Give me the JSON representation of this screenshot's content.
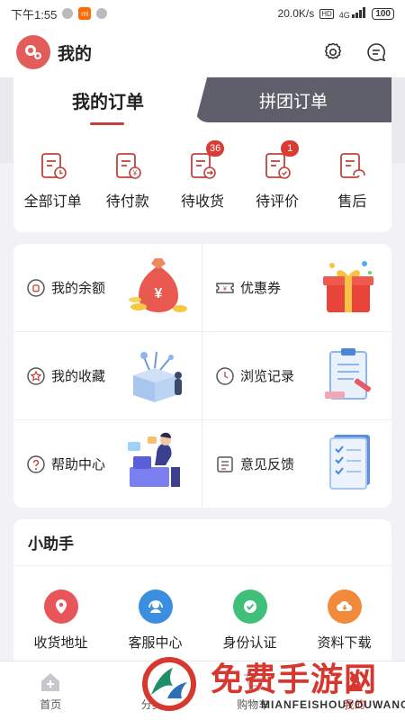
{
  "status_bar": {
    "time": "下午1:55",
    "speed": "20.0K/s",
    "hd": "HD",
    "network": "4G",
    "battery": "100"
  },
  "header": {
    "title": "我的"
  },
  "order_tabs": {
    "active": "我的订单",
    "inactive": "拼团订单"
  },
  "orders": [
    {
      "label": "全部订单",
      "badge": ""
    },
    {
      "label": "待付款",
      "badge": ""
    },
    {
      "label": "待收货",
      "badge": "36"
    },
    {
      "label": "待评价",
      "badge": "1"
    },
    {
      "label": "售后",
      "badge": ""
    }
  ],
  "services": [
    {
      "label": "我的余额",
      "icon": "wallet-icon"
    },
    {
      "label": "优惠券",
      "icon": "coupon-icon"
    },
    {
      "label": "我的收藏",
      "icon": "star-icon"
    },
    {
      "label": "浏览记录",
      "icon": "history-icon"
    },
    {
      "label": "帮助中心",
      "icon": "question-icon"
    },
    {
      "label": "意见反馈",
      "icon": "feedback-icon"
    }
  ],
  "helper": {
    "title": "小助手",
    "items": [
      {
        "label": "收货地址",
        "color": "#e8555a",
        "icon": "location-icon"
      },
      {
        "label": "客服中心",
        "color": "#3b8fe0",
        "icon": "headset-icon"
      },
      {
        "label": "身份认证",
        "color": "#3fbf7a",
        "icon": "verified-icon"
      },
      {
        "label": "资料下载",
        "color": "#f28a3c",
        "icon": "cloud-download-icon"
      }
    ]
  },
  "bottom_nav": [
    {
      "label": "首页",
      "icon": "home-icon"
    },
    {
      "label": "分类",
      "icon": "category-icon"
    },
    {
      "label": "购物车",
      "icon": "cart-icon"
    },
    {
      "label": "我的",
      "icon": "profile-icon"
    }
  ],
  "watermark": {
    "title": "免费手游网",
    "subtitle": "MIANFEISHOUYOUWANG"
  },
  "colors": {
    "accent": "#c0433b",
    "tab_dark": "#5f5e6b",
    "badge": "#d93b35"
  }
}
